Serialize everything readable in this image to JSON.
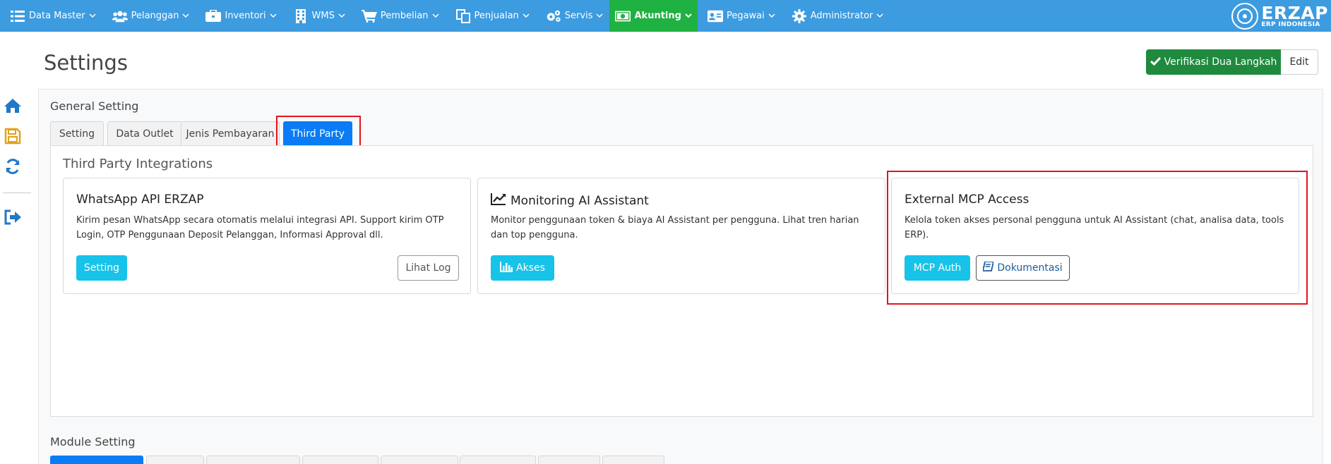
{
  "nav": {
    "items": [
      {
        "label": "Data Master",
        "icon": "list-icon"
      },
      {
        "label": "Pelanggan",
        "icon": "users-icon"
      },
      {
        "label": "Inventori",
        "icon": "briefcase-icon"
      },
      {
        "label": "WMS",
        "icon": "building-icon"
      },
      {
        "label": "Pembelian",
        "icon": "cart-icon"
      },
      {
        "label": "Penjualan",
        "icon": "copy-icon"
      },
      {
        "label": "Servis",
        "icon": "cogs-icon"
      },
      {
        "label": "Akunting",
        "icon": "money-icon"
      },
      {
        "label": "Pegawai",
        "icon": "id-card-icon"
      },
      {
        "label": "Administrator",
        "icon": "gear-icon"
      }
    ],
    "active": "Akunting",
    "brand_name": "ERZAP",
    "brand_sub": "ERP INDONESIA"
  },
  "sidebar": {
    "icons": [
      "home-icon",
      "save-icon",
      "refresh-icon",
      "sign-out-icon"
    ]
  },
  "page": {
    "title": "Settings",
    "verify_label": "Verifikasi Dua Langkah",
    "edit_label": "Edit"
  },
  "general": {
    "label": "General Setting",
    "tabs": [
      "Setting",
      "Data Outlet",
      "Jenis Pembayaran",
      "Third Party"
    ],
    "active_tab": "Third Party"
  },
  "third_party": {
    "title": "Third Party Integrations",
    "cards": [
      {
        "title": "WhatsApp API ERZAP",
        "desc": "Kirim pesan WhatsApp secara otomatis melalui integrasi API. Support kirim OTP Login, OTP Penggunaan Deposit Pelanggan, Informasi Approval dll.",
        "primary": "Setting",
        "secondary": "Lihat Log"
      },
      {
        "title": "Monitoring AI Assistant",
        "desc": "Monitor penggunaan token & biaya AI Assistant per pengguna. Lihat tren harian dan top pengguna.",
        "primary": "Akses"
      },
      {
        "title": "External MCP Access",
        "desc": "Kelola token akses personal pengguna untuk AI Assistant (chat, analisa data, tools ERP).",
        "primary": "MCP Auth",
        "secondary": "Dokumentasi"
      }
    ]
  },
  "module": {
    "label": "Module Setting"
  },
  "colors": {
    "nav_bg": "#3d9be0",
    "nav_active": "#1fb141",
    "primary_blue": "#0a7cf5",
    "info": "#17c3e8",
    "success": "#1f8a3e",
    "highlight": "#e2141e"
  }
}
